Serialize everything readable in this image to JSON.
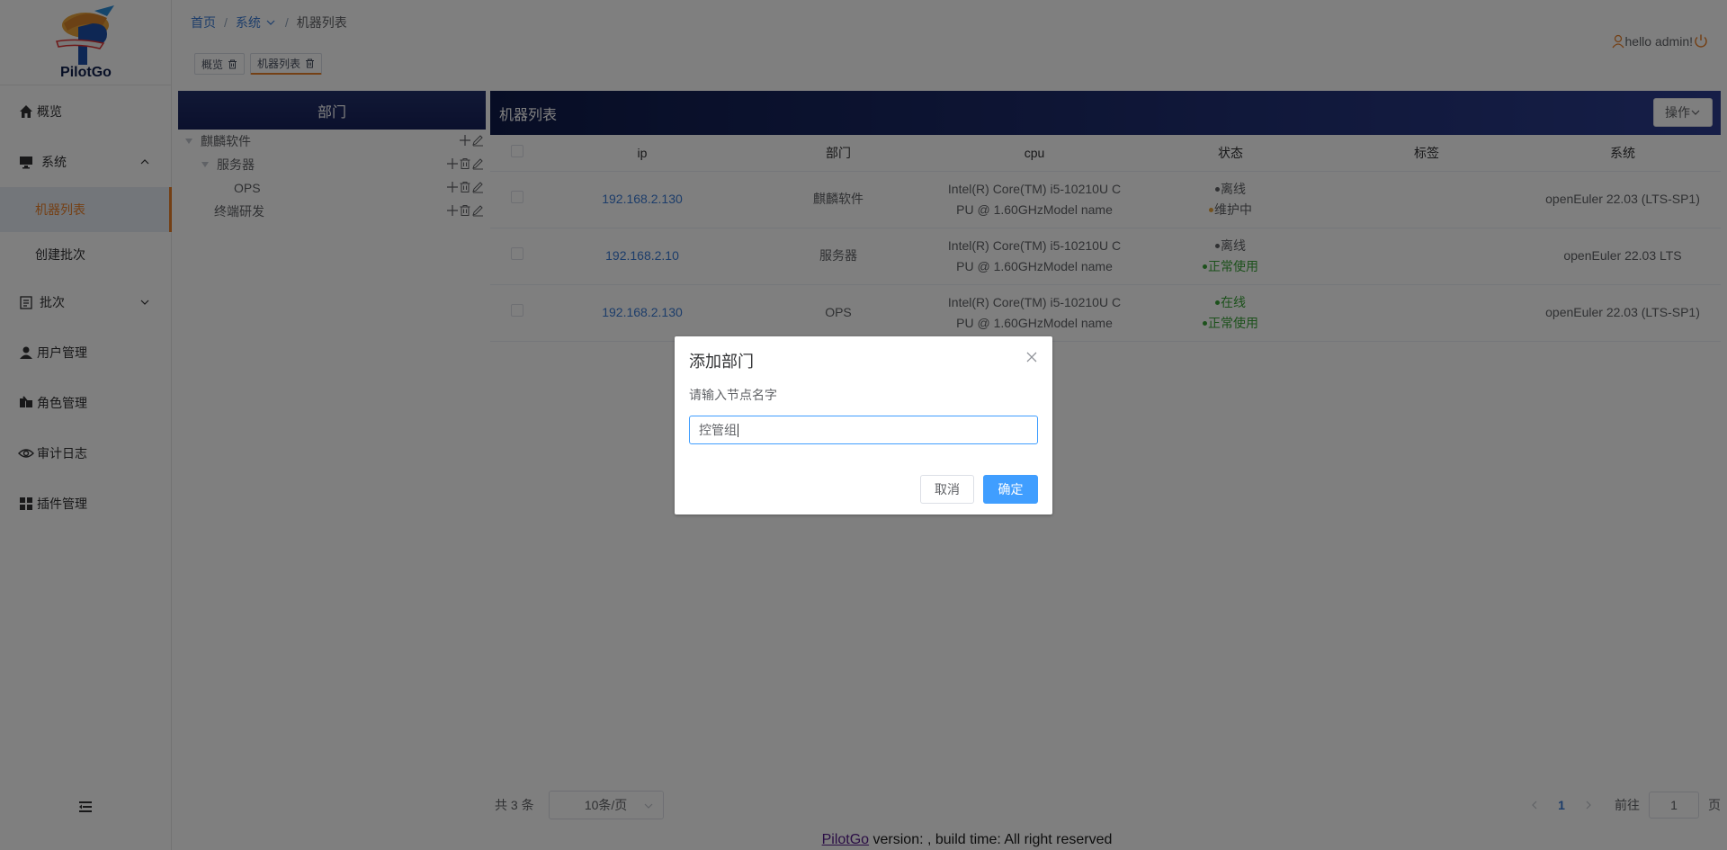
{
  "logo": {
    "text": "PilotGo"
  },
  "sidebar": {
    "items": [
      {
        "label": "概览",
        "icon": "home-icon"
      },
      {
        "label": "系统",
        "icon": "monitor-icon"
      },
      {
        "label": "批次",
        "icon": "batch-icon"
      },
      {
        "label": "用户管理",
        "icon": "user-icon"
      },
      {
        "label": "角色管理",
        "icon": "role-icon"
      },
      {
        "label": "审计日志",
        "icon": "eye-icon"
      },
      {
        "label": "插件管理",
        "icon": "grid-icon"
      }
    ],
    "sub_system": [
      {
        "label": "机器列表",
        "active": true
      },
      {
        "label": "创建批次",
        "active": false
      }
    ]
  },
  "breadcrumb": {
    "home": "首页",
    "system": "系统",
    "current": "机器列表"
  },
  "user": {
    "greeting": "hello admin!"
  },
  "tags": [
    {
      "label": "概览"
    },
    {
      "label": "机器列表"
    }
  ],
  "dept": {
    "title": "部门",
    "tree": [
      {
        "label": "麒麟软件"
      },
      {
        "label": "服务器"
      },
      {
        "label": "OPS"
      },
      {
        "label": "终端研发"
      }
    ]
  },
  "machine": {
    "title": "机器列表",
    "operate": "操作",
    "columns": [
      "ip",
      "部门",
      "cpu",
      "状态",
      "标签",
      "系统"
    ],
    "rows": [
      {
        "ip": "192.168.2.130",
        "dept": "麒麟软件",
        "cpu1": "Intel(R) Core(TM) i5-10210U C",
        "cpu2": "PU @ 1.60GHzModel name",
        "status1": "离线",
        "status2": "维护中",
        "label": "",
        "os": "openEuler 22.03 (LTS-SP1)"
      },
      {
        "ip": "192.168.2.10",
        "dept": "服务器",
        "cpu1": "Intel(R) Core(TM) i5-10210U C",
        "cpu2": "PU @ 1.60GHzModel name",
        "status1": "离线",
        "status2": "正常使用",
        "label": "",
        "os": "openEuler 22.03 LTS"
      },
      {
        "ip": "192.168.2.130",
        "dept": "OPS",
        "cpu1": "Intel(R) Core(TM) i5-10210U C",
        "cpu2": "PU @ 1.60GHzModel name",
        "status1": "在线",
        "status2": "正常使用",
        "label": "",
        "os": "openEuler 22.03 (LTS-SP1)"
      }
    ]
  },
  "pagination": {
    "total": "共 3 条",
    "page_size": "10条/页",
    "current_page": "1",
    "goto": "前往",
    "goto_value": "1",
    "page_unit": "页"
  },
  "footer": {
    "link": "PilotGo",
    "text": " version: , build time: All right reserved"
  },
  "dialog": {
    "title": "添加部门",
    "label": "请输入节点名字",
    "input_value": "控管组",
    "cancel": "取消",
    "confirm": "确定"
  },
  "colors": {
    "accent": "#e9802b",
    "primary": "#409eff",
    "header_dark": "#16215a",
    "online": "#3aa338"
  }
}
